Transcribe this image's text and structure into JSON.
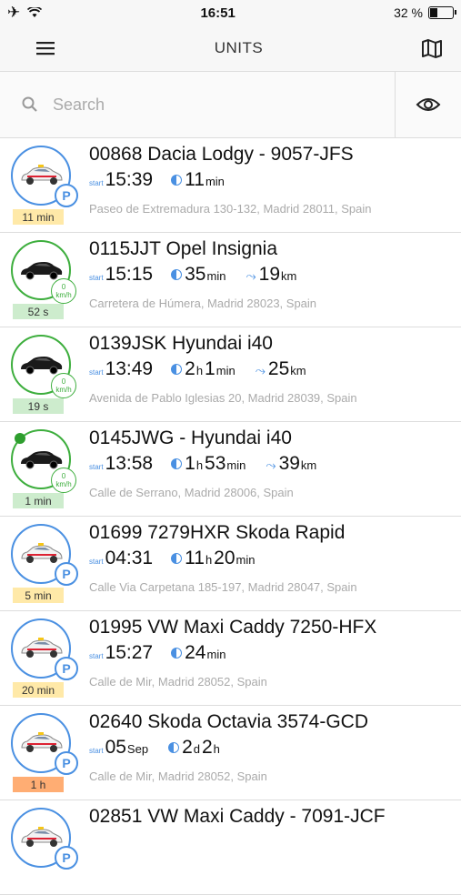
{
  "status": {
    "time": "16:51",
    "battery": "32 %",
    "battery_level": 0.32
  },
  "navbar": {
    "title": "UNITS",
    "menu_icon": "hamburger-icon",
    "map_icon": "map-icon"
  },
  "search": {
    "placeholder": "Search",
    "value": "",
    "eye_icon": "eye-icon"
  },
  "colors": {
    "blue": "#4a90e2",
    "green": "#3dae3d",
    "yellow": "#ffe9a8",
    "lightgreen": "#cdeccd",
    "orange": "#ffad73"
  },
  "units": [
    {
      "name": "00868 Dacia Lodgy - 9057-JFS",
      "start_label": "start",
      "start": "15:39",
      "dur": [
        [
          "11",
          "min"
        ]
      ],
      "dist": null,
      "address": "Paseo de Extremadura 130-132, Madrid 28011, Spain",
      "tag": "11 min",
      "tag_color": "yellow",
      "state": "parked",
      "car": "taxi"
    },
    {
      "name": "0115JJT Opel Insignia",
      "start_label": "start",
      "start": "15:15",
      "dur": [
        [
          "35",
          "min"
        ]
      ],
      "dist": [
        "19",
        "km"
      ],
      "address": "Carretera de Húmera, Madrid 28023, Spain",
      "tag": "52 s",
      "tag_color": "green",
      "state": "moving",
      "speed": "0",
      "speed_unit": "km/h",
      "car": "black"
    },
    {
      "name": "0139JSK Hyundai i40",
      "start_label": "start",
      "start": "13:49",
      "dur": [
        [
          "2",
          "h"
        ],
        [
          "1",
          "min"
        ]
      ],
      "dist": [
        "25",
        "km"
      ],
      "address": "Avenida de Pablo Iglesias 20, Madrid 28039, Spain",
      "tag": "19 s",
      "tag_color": "green",
      "state": "moving",
      "speed": "0",
      "speed_unit": "km/h",
      "car": "black"
    },
    {
      "name": "0145JWG - Hyundai i40",
      "start_label": "start",
      "start": "13:58",
      "dur": [
        [
          "1",
          "h"
        ],
        [
          "53",
          "min"
        ]
      ],
      "dist": [
        "39",
        "km"
      ],
      "address": "Calle de Serrano, Madrid 28006, Spain",
      "tag": "1 min",
      "tag_color": "green",
      "state": "moving",
      "speed": "0",
      "speed_unit": "km/h",
      "car": "black",
      "key": true
    },
    {
      "name": "01699 7279HXR Skoda Rapid",
      "start_label": "start",
      "start": "04:31",
      "dur": [
        [
          "11",
          "h"
        ],
        [
          "20",
          "min"
        ]
      ],
      "dist": null,
      "address": "Calle Via Carpetana 185-197, Madrid 28047, Spain",
      "tag": "5 min",
      "tag_color": "yellow",
      "state": "parked",
      "car": "taxi"
    },
    {
      "name": "01995 VW Maxi Caddy 7250-HFX",
      "start_label": "start",
      "start": "15:27",
      "dur": [
        [
          "24",
          "min"
        ]
      ],
      "dist": null,
      "address": "Calle de Mir, Madrid 28052, Spain",
      "tag": "20 min",
      "tag_color": "yellow",
      "state": "parked",
      "car": "taxi"
    },
    {
      "name": "02640 Skoda Octavia 3574-GCD",
      "start_label": "start",
      "start": "05",
      "start_sm": "Sep",
      "dur": [
        [
          "2",
          "d"
        ],
        [
          "2",
          "h"
        ]
      ],
      "dist": null,
      "address": "Calle de Mir, Madrid 28052, Spain",
      "tag": "1 h",
      "tag_color": "orange",
      "state": "parked",
      "car": "taxi"
    },
    {
      "name": "02851 VW Maxi Caddy - 7091-JCF",
      "start_label": "",
      "start": "",
      "dur": [],
      "dist": null,
      "address": "",
      "tag": "",
      "tag_color": "",
      "state": "parked",
      "car": "taxi"
    }
  ]
}
